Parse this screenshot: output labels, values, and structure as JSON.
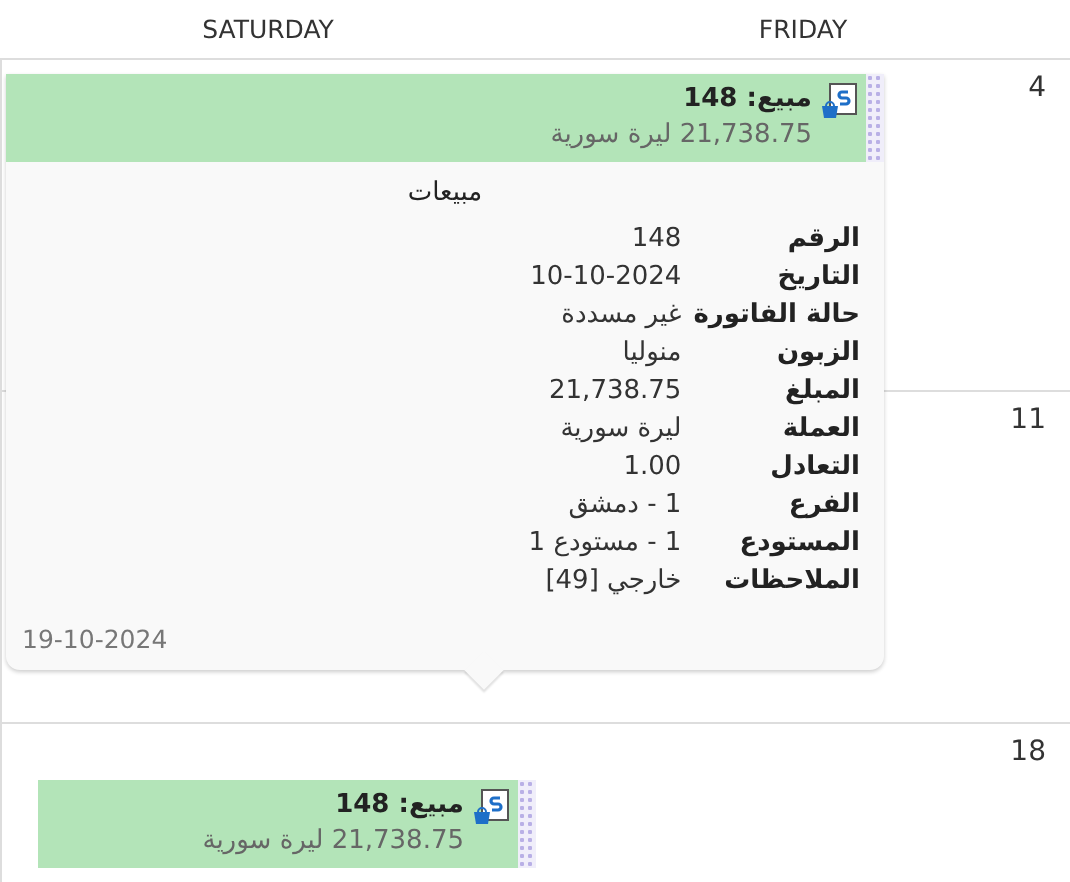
{
  "calendar": {
    "columns": [
      "FRIDAY",
      "SATURDAY"
    ],
    "weeks": [
      {
        "friday_day": "4"
      },
      {
        "friday_day": "11"
      },
      {
        "friday_day": "18",
        "saturday_appointment": {
          "title": "مبيع: 148",
          "subtitle": "21,738.75 ليرة سورية"
        }
      }
    ]
  },
  "popup": {
    "appointment": {
      "title": "مبيع: 148",
      "subtitle": "21,738.75 ليرة سورية"
    },
    "section_title": "مبيعات",
    "fields": [
      {
        "label": "الرقم",
        "value": "148"
      },
      {
        "label": "التاريخ",
        "value": "10-10-2024"
      },
      {
        "label": "حالة الفاتورة",
        "value": "غير مسددة"
      },
      {
        "label": "الزبون",
        "value": "منوليا"
      },
      {
        "label": "المبلغ",
        "value": "21,738.75"
      },
      {
        "label": "العملة",
        "value": "ليرة سورية"
      },
      {
        "label": "التعادل",
        "value": "1.00"
      },
      {
        "label": "الفرع",
        "value": "1 - دمشق"
      },
      {
        "label": "المستودع",
        "value": "1 - مستودع 1"
      },
      {
        "label": "الملاحظات",
        "value": "خارجي [49]"
      }
    ],
    "footer_date": "19-10-2024"
  }
}
